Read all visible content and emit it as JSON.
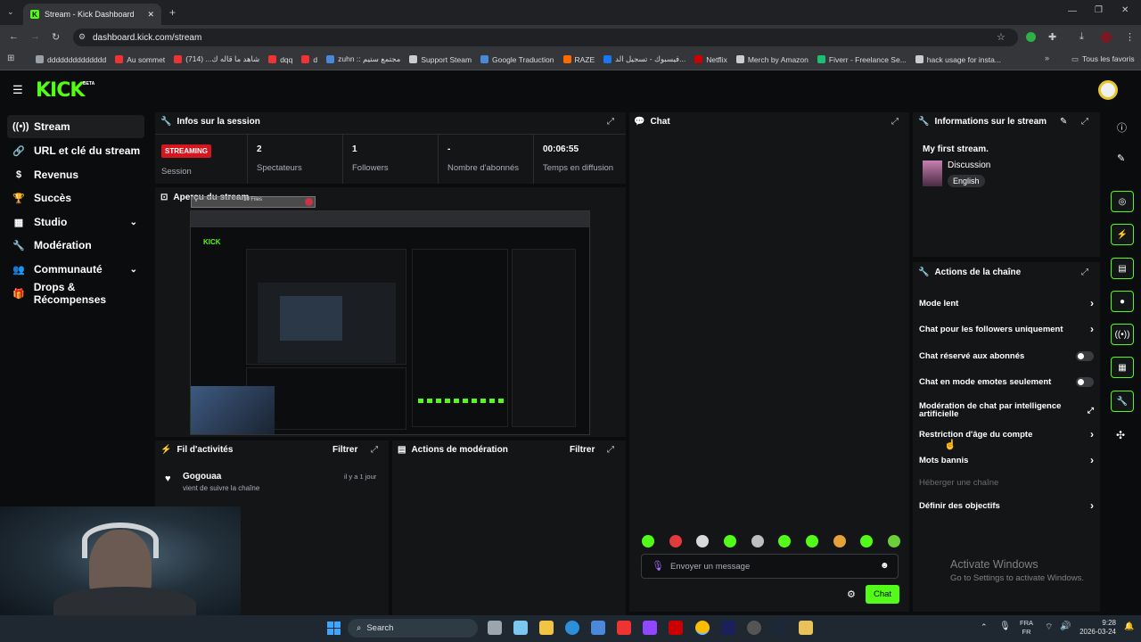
{
  "browser": {
    "tab_title": "Stream - Kick Dashboard",
    "url": "dashboard.kick.com/stream",
    "bookmarks": [
      "dddddddddddddd",
      "Au sommet",
      "شاهد ما قاله ك... (714)",
      "dqq",
      "d",
      "zuhn :: مجتمع ستيم",
      "Support Steam",
      "Google Traduction",
      "RAZE",
      "فيسبوك - تسجيل الد...",
      "Netflix",
      "Merch by Amazon",
      "Fiverr - Freelance Se...",
      "hack usage for insta..."
    ],
    "all_bookmarks": "Tous les favoris"
  },
  "brand": {
    "logo": "KICK",
    "beta": "BETA",
    "accent": "#53fc18"
  },
  "sidebar": {
    "items": [
      {
        "label": "Stream",
        "icon": "broadcast-icon"
      },
      {
        "label": "URL et clé du stream",
        "icon": "link-icon"
      },
      {
        "label": "Revenus",
        "icon": "money-icon"
      },
      {
        "label": "Succès",
        "icon": "trophy-icon"
      },
      {
        "label": "Studio",
        "icon": "studio-icon"
      },
      {
        "label": "Modération",
        "icon": "wrench-icon"
      },
      {
        "label": "Communauté",
        "icon": "community-icon"
      },
      {
        "label": "Drops & Récompenses",
        "icon": "gift-icon"
      }
    ]
  },
  "session": {
    "title": "Infos sur la session",
    "badge": "STREAMING",
    "badge_label": "Session",
    "viewers_value": "2",
    "viewers_label": "Spectateurs",
    "followers_value": "1",
    "followers_label": "Followers",
    "subs_value": "-",
    "subs_label": "Nombre d'abonnés",
    "time_value": "00:06:55",
    "time_label": "Temps en diffusion"
  },
  "preview": {
    "title": "Aperçu du stream",
    "overlay_label": "10 Files"
  },
  "activity": {
    "title": "Fil d'activités",
    "filter": "Filtrer",
    "entries": [
      {
        "user": "Gogouaa",
        "text": "vient de suivre la chaîne",
        "time": "il y a 1 jour"
      }
    ]
  },
  "moderation": {
    "title": "Actions de modération",
    "filter": "Filtrer"
  },
  "chat": {
    "title": "Chat",
    "placeholder": "Envoyer un message",
    "send": "Chat"
  },
  "stream_info": {
    "title": "Informations sur le stream",
    "stream_title": "My first stream.",
    "category": "Discussion",
    "language": "English"
  },
  "channel_actions": {
    "title": "Actions de la chaîne",
    "items": [
      {
        "label": "Mode lent",
        "control": "chevron"
      },
      {
        "label": "Chat pour les followers uniquement",
        "control": "chevron"
      },
      {
        "label": "Chat réservé aux abonnés",
        "control": "toggle"
      },
      {
        "label": "Chat en mode emotes seulement",
        "control": "toggle"
      },
      {
        "label": "Modération de chat par intelligence artificielle",
        "control": "external"
      },
      {
        "label": "Restriction d'âge du compte",
        "control": "chevron"
      },
      {
        "label": "Mots bannis",
        "control": "chevron"
      },
      {
        "label": "Héberger une chaîne",
        "control": "disabled"
      },
      {
        "label": "Définir des objectifs",
        "control": "chevron"
      }
    ]
  },
  "watermark": {
    "line1": "Activate Windows",
    "line2": "Go to Settings to activate Windows."
  },
  "taskbar": {
    "search": "Search",
    "lang1": "FRA",
    "lang2": "FR",
    "time": "9:28",
    "date": "2026-03-24"
  }
}
